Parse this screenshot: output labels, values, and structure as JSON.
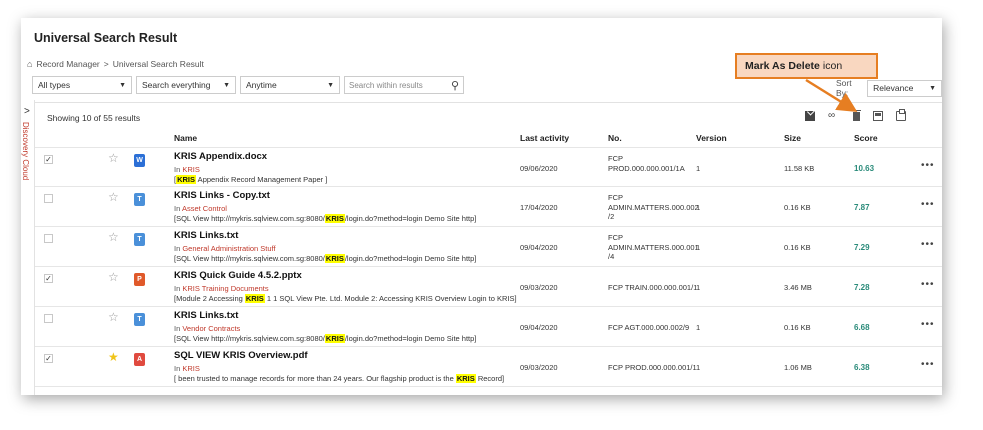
{
  "page": {
    "title": "Universal Search Result",
    "breadcrumb": [
      "Record Manager",
      "Universal Search Result"
    ]
  },
  "filters": {
    "types": "All types",
    "scope": "Search everything",
    "time": "Anytime",
    "search_placeholder": "Search within results"
  },
  "sort": {
    "label": "Sort By:",
    "value": "Relevance"
  },
  "sidebar": {
    "label": "Discovery Cloud"
  },
  "results": {
    "showing": "Showing 10 of 55 results"
  },
  "columns": {
    "name": "Name",
    "last_activity": "Last activity",
    "no": "No.",
    "version": "Version",
    "size": "Size",
    "score": "Score"
  },
  "rows": [
    {
      "checked": "✓",
      "file": "KRIS Appendix.docx",
      "in_prefix": "In ",
      "location": "KRIS",
      "snip_pre": "[",
      "snip_hl": "KRIS",
      "snip_post": " Appendix Record Management Paper ]",
      "date": "09/06/2020",
      "no1": "FCP",
      "no2": "PROD.000.000.001/1A",
      "no3": "",
      "version": "1",
      "size": "11.58 KB",
      "score": "10.63",
      "icon": "W",
      "icon_color": "#2b6fd6"
    },
    {
      "checked": "",
      "file": "KRIS Links - Copy.txt",
      "in_prefix": "In ",
      "location": "Asset Control",
      "snip_pre": "[SQL View http://mykris.sqlview.com.sg:8080/",
      "snip_hl": "KRIS",
      "snip_post": "/login.do?method=login Demo Site http]",
      "date": "17/04/2020",
      "no1": "FCP",
      "no2": "ADMIN.MATTERS.000.002",
      "no3": "/2",
      "version": "1",
      "size": "0.16 KB",
      "score": "7.87",
      "icon": "T",
      "icon_color": "#4a90d9"
    },
    {
      "checked": "",
      "file": "KRIS Links.txt",
      "in_prefix": "In ",
      "location": "General Administration Stuff",
      "snip_pre": "[SQL View http://mykris.sqlview.com.sg:8080/",
      "snip_hl": "KRIS",
      "snip_post": "/login.do?method=login Demo Site http]",
      "date": "09/04/2020",
      "no1": "FCP",
      "no2": "ADMIN.MATTERS.000.001",
      "no3": "/4",
      "version": "1",
      "size": "0.16 KB",
      "score": "7.29",
      "icon": "T",
      "icon_color": "#4a90d9"
    },
    {
      "checked": "✓",
      "file": "KRIS Quick Guide 4.5.2.pptx",
      "in_prefix": "In ",
      "location": "KRIS Training Documents",
      "snip_pre": "[Module 2 Accessing ",
      "snip_hl": "KRIS",
      "snip_post": " 1 1 SQL View Pte. Ltd. Module 2: Accessing KRIS Overview Login to KRIS]",
      "date": "09/03/2020",
      "no1": "FCP TRAIN.000.000.001/1",
      "no2": "",
      "no3": "",
      "version": "1",
      "size": "3.46 MB",
      "score": "7.28",
      "icon": "P",
      "icon_color": "#e0592a"
    },
    {
      "checked": "",
      "file": "KRIS Links.txt",
      "in_prefix": "In ",
      "location": "Vendor Contracts",
      "snip_pre": "[SQL View http://mykris.sqlview.com.sg:8080/",
      "snip_hl": "KRIS",
      "snip_post": "/login.do?method=login Demo Site http]",
      "date": "09/04/2020",
      "no1": "FCP AGT.000.000.002/9",
      "no2": "",
      "no3": "",
      "version": "1",
      "size": "0.16 KB",
      "score": "6.68",
      "icon": "T",
      "icon_color": "#4a90d9"
    },
    {
      "checked": "✓",
      "file": "SQL VIEW KRIS Overview.pdf",
      "in_prefix": "In ",
      "location": "KRIS",
      "snip_pre": "[ been trusted to manage records for more than 24 years. Our flagship product is the ",
      "snip_hl": "KRIS",
      "snip_post": " Record]",
      "date": "09/03/2020",
      "no1": "FCP PROD.000.000.001/1",
      "no2": "",
      "no3": "",
      "version": "1",
      "size": "1.06 MB",
      "score": "6.38",
      "icon": "A",
      "icon_color": "#e04a3f",
      "starred": true
    }
  ],
  "callout": {
    "bold": "Mark As Delete",
    "rest": "icon"
  },
  "colors": {
    "accent": "#e67e22",
    "score": "#2a8b7a",
    "location": "#c0392b",
    "highlight": "#ffff00"
  }
}
